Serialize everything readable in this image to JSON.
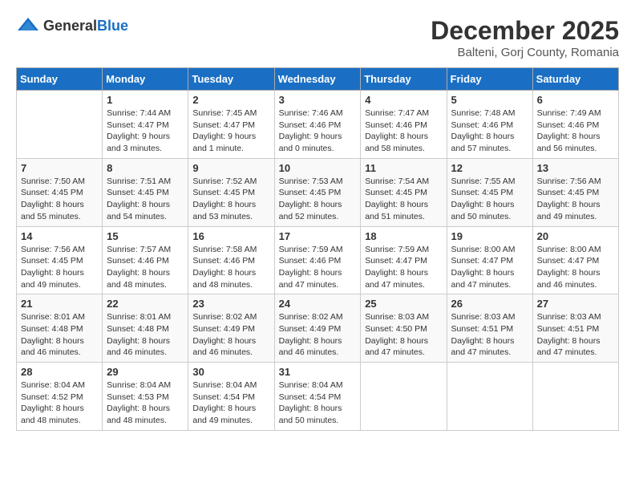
{
  "logo": {
    "general": "General",
    "blue": "Blue"
  },
  "title": {
    "month": "December 2025",
    "location": "Balteni, Gorj County, Romania"
  },
  "days_of_week": [
    "Sunday",
    "Monday",
    "Tuesday",
    "Wednesday",
    "Thursday",
    "Friday",
    "Saturday"
  ],
  "weeks": [
    [
      {
        "day": "",
        "sunrise": "",
        "sunset": "",
        "daylight": ""
      },
      {
        "day": "1",
        "sunrise": "Sunrise: 7:44 AM",
        "sunset": "Sunset: 4:47 PM",
        "daylight": "Daylight: 9 hours and 3 minutes."
      },
      {
        "day": "2",
        "sunrise": "Sunrise: 7:45 AM",
        "sunset": "Sunset: 4:47 PM",
        "daylight": "Daylight: 9 hours and 1 minute."
      },
      {
        "day": "3",
        "sunrise": "Sunrise: 7:46 AM",
        "sunset": "Sunset: 4:46 PM",
        "daylight": "Daylight: 9 hours and 0 minutes."
      },
      {
        "day": "4",
        "sunrise": "Sunrise: 7:47 AM",
        "sunset": "Sunset: 4:46 PM",
        "daylight": "Daylight: 8 hours and 58 minutes."
      },
      {
        "day": "5",
        "sunrise": "Sunrise: 7:48 AM",
        "sunset": "Sunset: 4:46 PM",
        "daylight": "Daylight: 8 hours and 57 minutes."
      },
      {
        "day": "6",
        "sunrise": "Sunrise: 7:49 AM",
        "sunset": "Sunset: 4:46 PM",
        "daylight": "Daylight: 8 hours and 56 minutes."
      }
    ],
    [
      {
        "day": "7",
        "sunrise": "Sunrise: 7:50 AM",
        "sunset": "Sunset: 4:45 PM",
        "daylight": "Daylight: 8 hours and 55 minutes."
      },
      {
        "day": "8",
        "sunrise": "Sunrise: 7:51 AM",
        "sunset": "Sunset: 4:45 PM",
        "daylight": "Daylight: 8 hours and 54 minutes."
      },
      {
        "day": "9",
        "sunrise": "Sunrise: 7:52 AM",
        "sunset": "Sunset: 4:45 PM",
        "daylight": "Daylight: 8 hours and 53 minutes."
      },
      {
        "day": "10",
        "sunrise": "Sunrise: 7:53 AM",
        "sunset": "Sunset: 4:45 PM",
        "daylight": "Daylight: 8 hours and 52 minutes."
      },
      {
        "day": "11",
        "sunrise": "Sunrise: 7:54 AM",
        "sunset": "Sunset: 4:45 PM",
        "daylight": "Daylight: 8 hours and 51 minutes."
      },
      {
        "day": "12",
        "sunrise": "Sunrise: 7:55 AM",
        "sunset": "Sunset: 4:45 PM",
        "daylight": "Daylight: 8 hours and 50 minutes."
      },
      {
        "day": "13",
        "sunrise": "Sunrise: 7:56 AM",
        "sunset": "Sunset: 4:45 PM",
        "daylight": "Daylight: 8 hours and 49 minutes."
      }
    ],
    [
      {
        "day": "14",
        "sunrise": "Sunrise: 7:56 AM",
        "sunset": "Sunset: 4:45 PM",
        "daylight": "Daylight: 8 hours and 49 minutes."
      },
      {
        "day": "15",
        "sunrise": "Sunrise: 7:57 AM",
        "sunset": "Sunset: 4:46 PM",
        "daylight": "Daylight: 8 hours and 48 minutes."
      },
      {
        "day": "16",
        "sunrise": "Sunrise: 7:58 AM",
        "sunset": "Sunset: 4:46 PM",
        "daylight": "Daylight: 8 hours and 48 minutes."
      },
      {
        "day": "17",
        "sunrise": "Sunrise: 7:59 AM",
        "sunset": "Sunset: 4:46 PM",
        "daylight": "Daylight: 8 hours and 47 minutes."
      },
      {
        "day": "18",
        "sunrise": "Sunrise: 7:59 AM",
        "sunset": "Sunset: 4:47 PM",
        "daylight": "Daylight: 8 hours and 47 minutes."
      },
      {
        "day": "19",
        "sunrise": "Sunrise: 8:00 AM",
        "sunset": "Sunset: 4:47 PM",
        "daylight": "Daylight: 8 hours and 47 minutes."
      },
      {
        "day": "20",
        "sunrise": "Sunrise: 8:00 AM",
        "sunset": "Sunset: 4:47 PM",
        "daylight": "Daylight: 8 hours and 46 minutes."
      }
    ],
    [
      {
        "day": "21",
        "sunrise": "Sunrise: 8:01 AM",
        "sunset": "Sunset: 4:48 PM",
        "daylight": "Daylight: 8 hours and 46 minutes."
      },
      {
        "day": "22",
        "sunrise": "Sunrise: 8:01 AM",
        "sunset": "Sunset: 4:48 PM",
        "daylight": "Daylight: 8 hours and 46 minutes."
      },
      {
        "day": "23",
        "sunrise": "Sunrise: 8:02 AM",
        "sunset": "Sunset: 4:49 PM",
        "daylight": "Daylight: 8 hours and 46 minutes."
      },
      {
        "day": "24",
        "sunrise": "Sunrise: 8:02 AM",
        "sunset": "Sunset: 4:49 PM",
        "daylight": "Daylight: 8 hours and 46 minutes."
      },
      {
        "day": "25",
        "sunrise": "Sunrise: 8:03 AM",
        "sunset": "Sunset: 4:50 PM",
        "daylight": "Daylight: 8 hours and 47 minutes."
      },
      {
        "day": "26",
        "sunrise": "Sunrise: 8:03 AM",
        "sunset": "Sunset: 4:51 PM",
        "daylight": "Daylight: 8 hours and 47 minutes."
      },
      {
        "day": "27",
        "sunrise": "Sunrise: 8:03 AM",
        "sunset": "Sunset: 4:51 PM",
        "daylight": "Daylight: 8 hours and 47 minutes."
      }
    ],
    [
      {
        "day": "28",
        "sunrise": "Sunrise: 8:04 AM",
        "sunset": "Sunset: 4:52 PM",
        "daylight": "Daylight: 8 hours and 48 minutes."
      },
      {
        "day": "29",
        "sunrise": "Sunrise: 8:04 AM",
        "sunset": "Sunset: 4:53 PM",
        "daylight": "Daylight: 8 hours and 48 minutes."
      },
      {
        "day": "30",
        "sunrise": "Sunrise: 8:04 AM",
        "sunset": "Sunset: 4:54 PM",
        "daylight": "Daylight: 8 hours and 49 minutes."
      },
      {
        "day": "31",
        "sunrise": "Sunrise: 8:04 AM",
        "sunset": "Sunset: 4:54 PM",
        "daylight": "Daylight: 8 hours and 50 minutes."
      },
      {
        "day": "",
        "sunrise": "",
        "sunset": "",
        "daylight": ""
      },
      {
        "day": "",
        "sunrise": "",
        "sunset": "",
        "daylight": ""
      },
      {
        "day": "",
        "sunrise": "",
        "sunset": "",
        "daylight": ""
      }
    ]
  ]
}
